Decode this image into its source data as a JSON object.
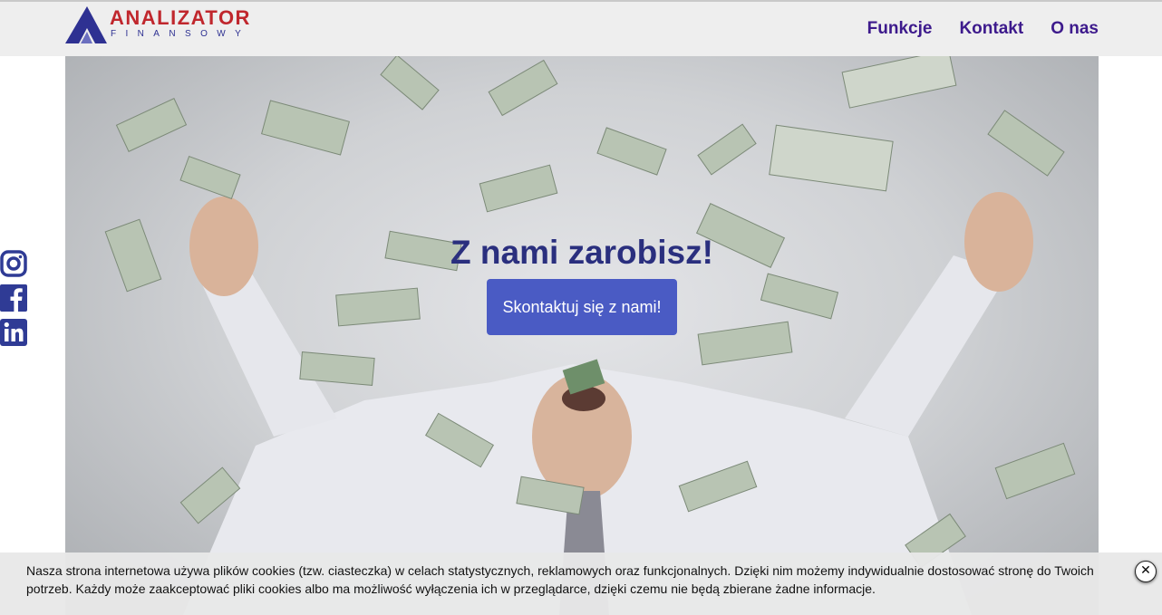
{
  "header": {
    "logo": {
      "name": "ANALIZATOR",
      "subtitle": "FINANSOWY"
    },
    "nav": [
      {
        "label": "Funkcje"
      },
      {
        "label": "Kontakt"
      },
      {
        "label": "O nas"
      }
    ]
  },
  "hero": {
    "title": "Z nami zarobisz!",
    "cta_label": "Skontaktuj się z nami!"
  },
  "social": [
    "instagram-icon",
    "facebook-icon",
    "linkedin-icon"
  ],
  "cookie_banner": {
    "text": "Nasza strona internetowa używa plików cookies (tzw. ciasteczka) w celach statystycznych, reklamowych oraz funkcjonalnych. Dzięki nim możemy indywidualnie dostosować stronę do Twoich potrzeb. Każdy może zaakceptować pliki cookies albo ma możliwość wyłączenia ich w przeglądarce, dzięki czemu nie będą zbierane żadne informacje.",
    "close_label": "✕"
  },
  "colors": {
    "brand_red": "#c0272d",
    "brand_navy": "#2e3192",
    "nav_text": "#3d1a8c",
    "cta_bg": "#4a5bc4",
    "social_blue": "#2f3b95"
  }
}
